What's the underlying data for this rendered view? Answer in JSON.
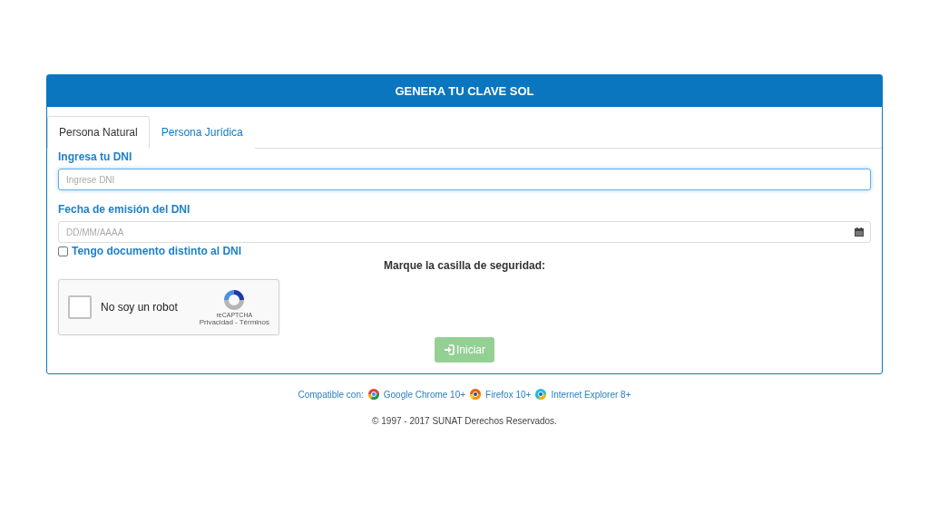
{
  "panel": {
    "title": "GENERA TU CLAVE SOL"
  },
  "tabs": [
    {
      "label": "Persona Natural",
      "selected": true
    },
    {
      "label": "Persona Jurídica",
      "selected": false
    }
  ],
  "dni": {
    "label": "Ingresa tu DNI",
    "placeholder": "Ingrese DNI"
  },
  "date": {
    "label": "Fecha de emisión del DNI",
    "placeholder": "DD/MM/AAAA"
  },
  "other_document": {
    "label": "Tengo documento distinto al DNI",
    "checked": false
  },
  "security": {
    "label": "Marque la casilla de seguridad:"
  },
  "captcha": {
    "label": "No soy un robot",
    "checked": false,
    "brand": "reCAPTCHA",
    "privacy": "Privacidad",
    "separator": "-",
    "terms": "Términos"
  },
  "submit": {
    "label": "Iniciar",
    "disabled": true
  },
  "compatibility": {
    "label": "Compatible con:",
    "browsers": [
      {
        "kind": "chrome",
        "name": "Google Chrome 10+"
      },
      {
        "kind": "firefox",
        "name": "Firefox 10+"
      },
      {
        "kind": "ie",
        "name": "Internet Explorer 8+"
      }
    ]
  },
  "footer": "© 1997 - 2017 SUNAT Derechos Reservados."
}
